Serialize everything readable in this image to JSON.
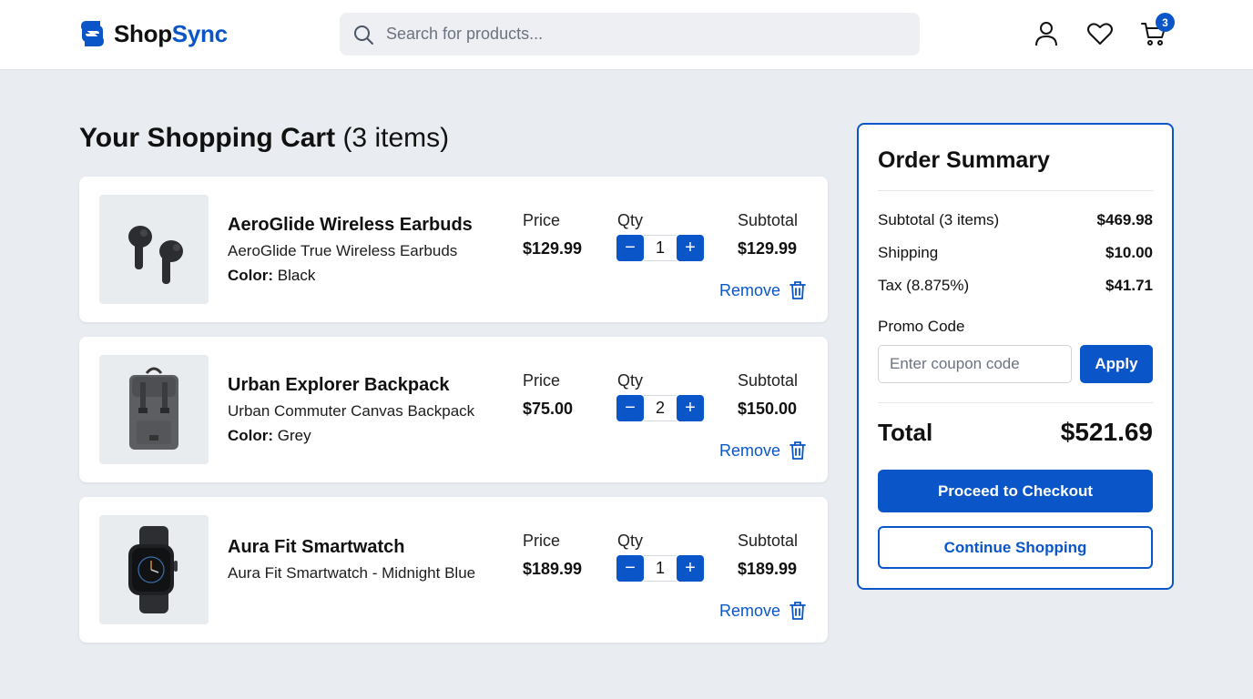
{
  "colors": {
    "accent": "#0a56c8",
    "background": "#e9edf2",
    "card": "#ffffff"
  },
  "header": {
    "logo_shop": "Shop",
    "logo_sync": "Sync",
    "search_placeholder": "Search for products...",
    "cart_count": "3",
    "icons": [
      "user-icon",
      "heart-icon",
      "cart-icon"
    ]
  },
  "cart": {
    "title": "Your Shopping Cart",
    "count_label": "(3 items)",
    "price_label": "Price",
    "qty_label": "Qty",
    "subtotal_label": "Subtotal",
    "remove_label": "Remove",
    "color_label": "Color:",
    "items": [
      {
        "name": "AeroGlide Wireless Earbuds",
        "subtitle": "AeroGlide True Wireless Earbuds",
        "color": "Black",
        "price": "$129.99",
        "qty": "1",
        "subtotal": "$129.99"
      },
      {
        "name": "Urban Explorer Backpack",
        "subtitle": "Urban Commuter Canvas Backpack",
        "color": "Grey",
        "price": "$75.00",
        "qty": "2",
        "subtotal": "$150.00"
      },
      {
        "name": "Aura Fit Smartwatch",
        "subtitle": "Aura Fit Smartwatch - Midnight Blue",
        "color": "",
        "price": "$189.99",
        "qty": "1",
        "subtotal": "$189.99"
      }
    ]
  },
  "summary": {
    "title": "Order Summary",
    "subtotal_label": "Subtotal (3 items)",
    "subtotal_value": "$469.98",
    "shipping_label": "Shipping",
    "shipping_value": "$10.00",
    "tax_label": "Tax (8.875%)",
    "tax_value": "$41.71",
    "promo_label": "Promo Code",
    "promo_placeholder": "Enter coupon code",
    "apply_label": "Apply",
    "total_label": "Total",
    "total_value": "$521.69",
    "checkout_label": "Proceed to Checkout",
    "continue_label": "Continue Shopping"
  }
}
